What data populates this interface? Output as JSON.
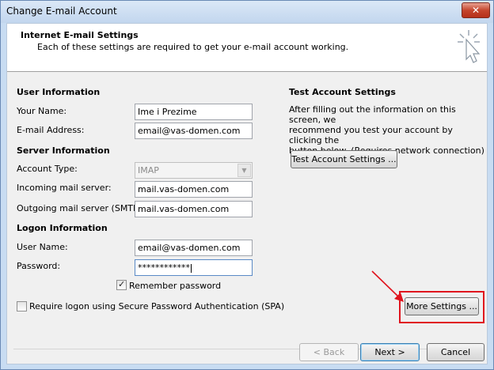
{
  "window": {
    "title": "Change E-mail Account",
    "close_glyph": "✕"
  },
  "header": {
    "title": "Internet E-mail Settings",
    "subtitle": "Each of these settings are required to get your e-mail account working.",
    "icon": "cursor-sparkle-icon"
  },
  "user_info": {
    "heading": "User Information",
    "name_label": "Your Name:",
    "name_value": "Ime i Prezime",
    "email_label": "E-mail Address:",
    "email_value": "email@vas-domen.com"
  },
  "server_info": {
    "heading": "Server Information",
    "account_type_label": "Account Type:",
    "account_type_value": "IMAP",
    "incoming_label": "Incoming mail server:",
    "incoming_value": "mail.vas-domen.com",
    "outgoing_label": "Outgoing mail server (SMTP):",
    "outgoing_value": "mail.vas-domen.com"
  },
  "logon_info": {
    "heading": "Logon Information",
    "username_label": "User Name:",
    "username_value": "email@vas-domen.com",
    "password_label": "Password:",
    "password_value": "************",
    "remember_label": "Remember password",
    "remember_checked": true,
    "spa_label": "Require logon using Secure Password Authentication (SPA)",
    "spa_checked": false
  },
  "test_settings": {
    "heading": "Test Account Settings",
    "description_lines": [
      "After filling out the information on this screen, we",
      "recommend you test your account by clicking the",
      "button below. (Requires network connection)"
    ],
    "test_button": "Test Account Settings ..."
  },
  "buttons": {
    "more_settings": "More Settings ...",
    "back": "< Back",
    "next": "Next >",
    "cancel": "Cancel"
  },
  "annotation": {
    "highlight_color": "#e0141e"
  }
}
